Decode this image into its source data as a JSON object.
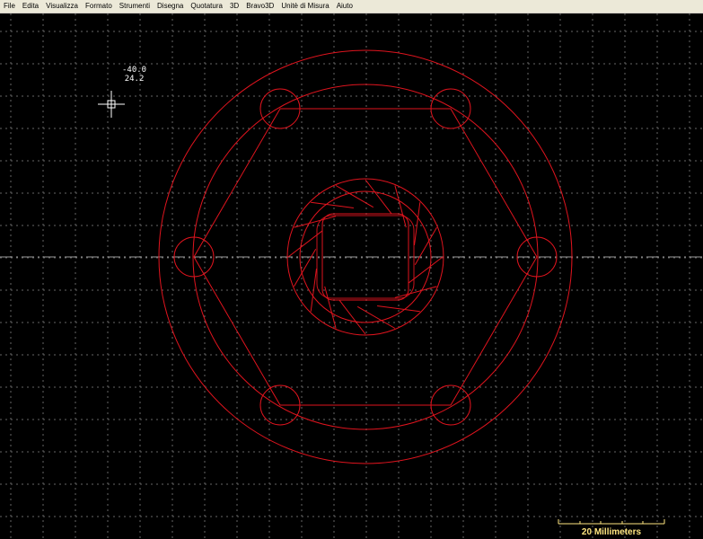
{
  "menu": {
    "items": [
      "File",
      "Edita",
      "Visualizza",
      "Formato",
      "Strumenti",
      "Disegna",
      "Quotatura",
      "3D",
      "Bravo3D",
      "Unitè di Misura",
      "Aiuto"
    ]
  },
  "cursor": {
    "x_readout": "-40.0",
    "y_readout": "24.2"
  },
  "scale_bar": {
    "label": "20  Millimeters"
  },
  "colors": {
    "background": "#000000",
    "drawing": "#e0141e",
    "grid": "#6e6e6e",
    "scale": "#ffe680"
  }
}
